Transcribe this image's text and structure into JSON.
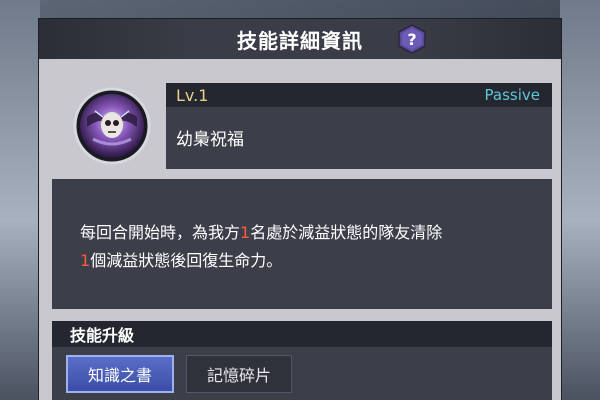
{
  "header": {
    "title": "技能詳細資訊",
    "help_icon": "question-mark-icon"
  },
  "skill": {
    "level": "Lv.1",
    "type": "Passive",
    "name": "幼梟祝福",
    "icon": "owl-skull-skill-icon"
  },
  "description": {
    "line1_a": "每回合開始時，為我方",
    "line1_num": "1",
    "line1_b": "名處於減益狀態的隊友清除",
    "line2_num": "1",
    "line2_b": "個減益狀態後回復生命力。"
  },
  "upgrade": {
    "title": "技能升級",
    "tabs": [
      {
        "label": "知識之書",
        "active": true
      },
      {
        "label": "記憶碎片",
        "active": false
      }
    ]
  },
  "colors": {
    "level": "#e6d38a",
    "passive": "#5fc6d6",
    "highlight": "#ff5a3c",
    "active_tab": "#3a4ea8",
    "help_badge": "#5a4a9a"
  }
}
